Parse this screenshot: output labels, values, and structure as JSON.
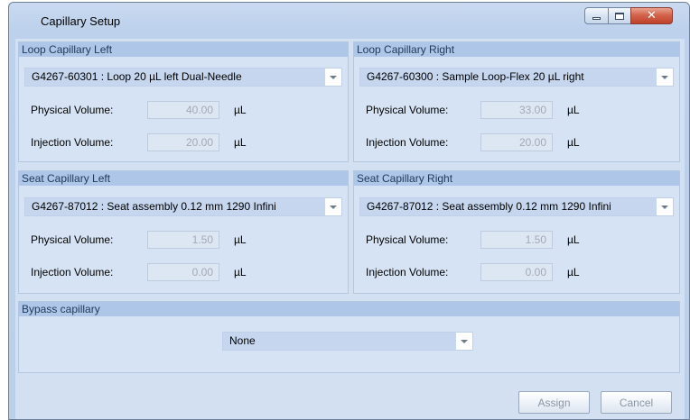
{
  "window": {
    "title": "Capillary Setup"
  },
  "loop_left": {
    "header": "Loop Capillary Left",
    "selection": "G4267-60301 : Loop 20 µL left Dual-Needle",
    "physical_label": "Physical Volume:",
    "physical_value": "40.00",
    "injection_label": "Injection Volume:",
    "injection_value": "20.00",
    "unit": "µL"
  },
  "loop_right": {
    "header": "Loop Capillary Right",
    "selection": "G4267-60300 : Sample Loop-Flex 20 µL right",
    "physical_label": "Physical Volume:",
    "physical_value": "33.00",
    "injection_label": "Injection Volume:",
    "injection_value": "20.00",
    "unit": "µL"
  },
  "seat_left": {
    "header": "Seat Capillary Left",
    "selection": "G4267-87012 : Seat assembly 0.12 mm 1290 Infini",
    "physical_label": "Physical Volume:",
    "physical_value": "1.50",
    "injection_label": "Injection Volume:",
    "injection_value": "0.00",
    "unit": "µL"
  },
  "seat_right": {
    "header": "Seat Capillary Right",
    "selection": "G4267-87012 : Seat assembly 0.12 mm 1290 Infini",
    "physical_label": "Physical Volume:",
    "physical_value": "1.50",
    "injection_label": "Injection Volume:",
    "injection_value": "0.00",
    "unit": "µL"
  },
  "bypass": {
    "header": "Bypass capillary",
    "selection": "None"
  },
  "buttons": {
    "assign": "Assign",
    "cancel": "Cancel"
  },
  "colors": {
    "header_bg": "#aec6e8",
    "header_text": "#1e395b",
    "combo_bg": "#c5d6ee",
    "close_red": "#c0412a"
  },
  "icons": [
    "minimize-icon",
    "maximize-icon",
    "close-icon",
    "dropdown-arrow-icon"
  ]
}
